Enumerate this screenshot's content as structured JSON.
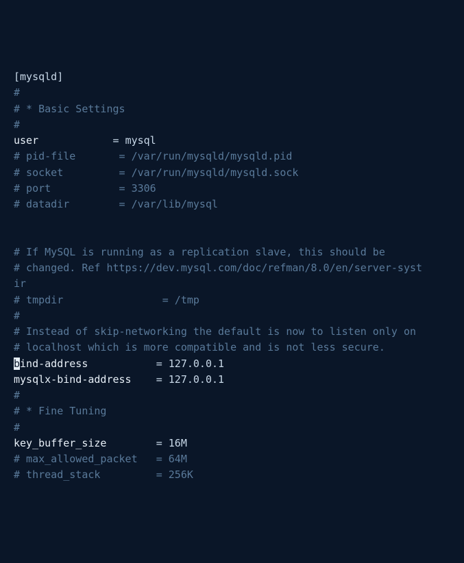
{
  "config": {
    "section_header": "[mysqld]",
    "comments": {
      "hash": "#",
      "basic_settings": "# * Basic Settings",
      "pid_file": "# pid-file       = /var/run/mysqld/mysqld.pid",
      "socket": "# socket         = /var/run/mysqld/mysqld.sock",
      "port": "# port           = 3306",
      "datadir": "# datadir        = /var/lib/mysql",
      "replication1": "# If MySQL is running as a replication slave, this should be",
      "replication2": "# changed. Ref https://dev.mysql.com/doc/refman/8.0/en/server-syst",
      "replication3": "ir",
      "tmpdir": "# tmpdir                = /tmp",
      "skip_net1": "# Instead of skip-networking the default is now to listen only on",
      "skip_net2": "# localhost which is more compatible and is not less secure.",
      "fine_tuning": "# * Fine Tuning",
      "max_allowed": "# max_allowed_packet   = 64M",
      "thread_stack": "# thread_stack         = 256K"
    },
    "settings": {
      "user": {
        "key": "user            ",
        "eq": "= ",
        "value": "mysql"
      },
      "bind_address": {
        "cursor_char": "b",
        "key_rest": "ind-address           ",
        "eq": "= ",
        "value": "127.0.0.1"
      },
      "mysqlx_bind": {
        "key": "mysqlx-bind-address    ",
        "eq": "= ",
        "value": "127.0.0.1"
      },
      "key_buffer": {
        "key": "key_buffer_size        ",
        "eq": "= ",
        "value": "16M"
      }
    }
  }
}
